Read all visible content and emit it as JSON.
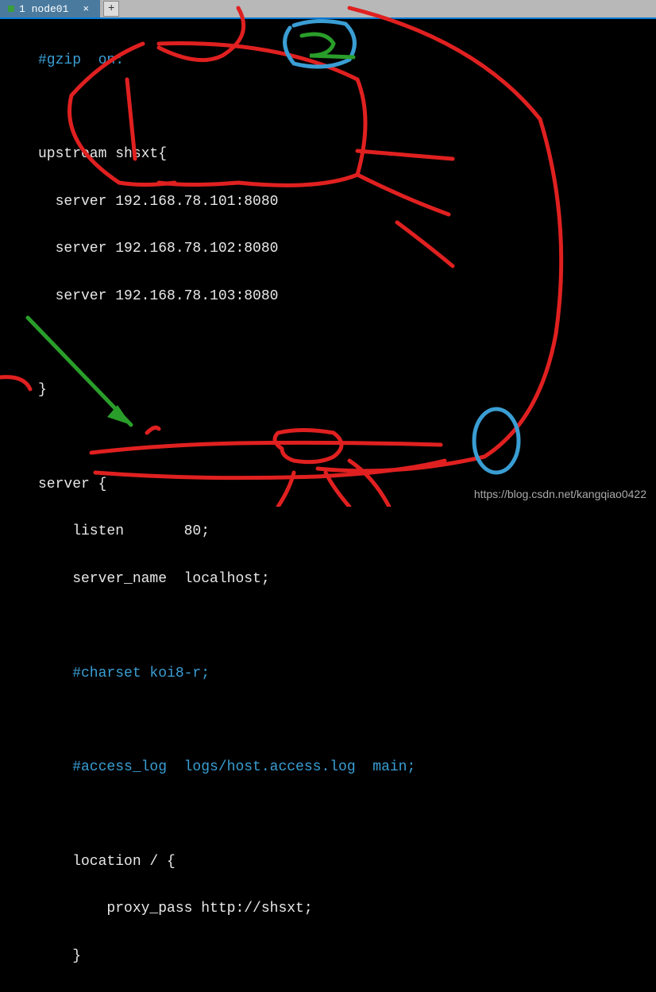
{
  "tab": {
    "label": "1 node01",
    "close": "×",
    "add": "+"
  },
  "code": {
    "line1_comment": "#gzip  on:",
    "line2_upstream": "upstream shsxt{",
    "line3_server1": "  server 192.168.78.101:8080",
    "line4_server2": "  server 192.168.78.102:8080",
    "line5_server3": "  server 192.168.78.103:8080",
    "line6_blank": "",
    "line7_close": "}",
    "line8_blank": "",
    "line9_server": "server {",
    "line10_listen": "    listen       80;",
    "line11_servername": "    server_name  localhost;",
    "line12_blank": "",
    "line13_charset": "    #charset koi8-r;",
    "line14_blank": "",
    "line15_accesslog": "    #access_log  logs/host.access.log  main;",
    "line16_blank": "",
    "line17_location": "    location / {",
    "line18_proxy": "        proxy_pass http://shsxt;",
    "line19_close": "    }"
  },
  "watermark": "https://blog.csdn.net/kangqiao0422",
  "annotations": {
    "color_red": "#e02020",
    "color_blue": "#3a9ed4",
    "color_green": "#2a9e2a"
  }
}
